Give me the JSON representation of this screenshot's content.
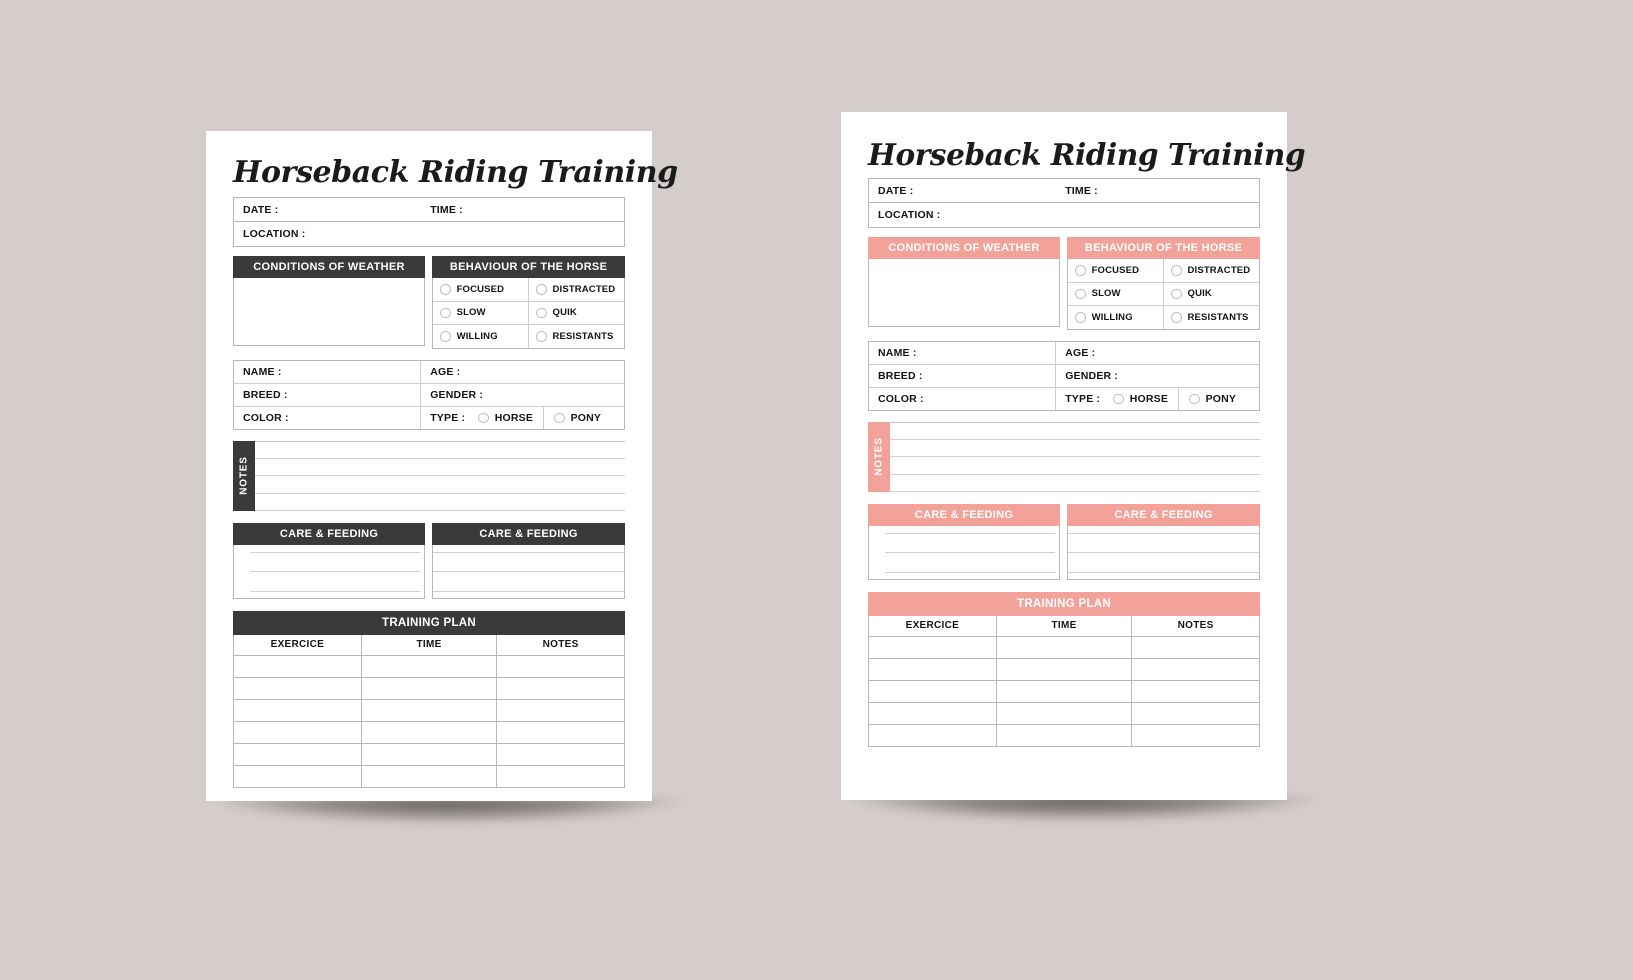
{
  "background_color": "#d5cdcb",
  "theme": {
    "dark_accent": "#3a3a3c",
    "pink_accent": "#f3a299",
    "line_color": "#b9b7b6",
    "text_color": "#141414"
  },
  "title": "Horseback Riding Training",
  "header_fields": {
    "date_label": "DATE :",
    "time_label": "TIME :",
    "location_label": "LOCATION :"
  },
  "weather_panel": {
    "heading": "CONDITIONS OF WEATHER"
  },
  "behaviour_panel": {
    "heading": "BEHAVIOUR OF THE HORSE",
    "options": [
      [
        "FOCUSED",
        "DISTRACTED"
      ],
      [
        "SLOW",
        "QUIK"
      ],
      [
        "WILLING",
        "RESISTANTS"
      ]
    ]
  },
  "horse_info": {
    "name_label": "NAME :",
    "age_label": "AGE :",
    "breed_label": "BREED :",
    "gender_label": "GENDER :",
    "color_label": "COLOR :",
    "type_label": "TYPE :",
    "type_option_horse": "HORSE",
    "type_option_pony": "PONY"
  },
  "notes": {
    "tab_label": "NOTES",
    "line_count": 5
  },
  "care_feeding": {
    "left_heading": "CARE & FEEDING",
    "right_heading": "CARE & FEEDING",
    "line_count": 3
  },
  "training_plan": {
    "heading": "TRAINING PLAN",
    "columns": [
      "EXERCICE",
      "TIME",
      "NOTES"
    ],
    "empty_rows_dark": 6,
    "empty_rows_pink": 5
  },
  "pages": [
    {
      "id": "dark-variant",
      "accent": "#3a3a3c"
    },
    {
      "id": "pink-variant",
      "accent": "#f3a299"
    }
  ]
}
